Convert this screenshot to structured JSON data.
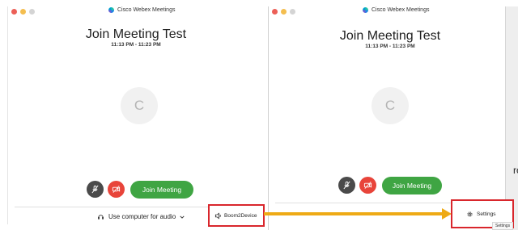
{
  "app_title": "Cisco Webex Meetings",
  "left_window": {
    "meeting_title": "Join Meeting Test",
    "meeting_time": "11:13 PM - 11:23 PM",
    "avatar_initial": "C",
    "join_label": "Join Meeting",
    "audio_option": "Use computer for audio",
    "audio_device": "Boom2Device"
  },
  "right_window": {
    "meeting_title": "Join Meeting Test",
    "meeting_time": "11:13 PM - 11:23 PM",
    "avatar_initial": "C",
    "join_label": "Join Meeting",
    "settings_label": "Settings",
    "settings_tooltip": "Settings"
  },
  "side_char": "rc",
  "colors": {
    "join_green": "#3fa543",
    "video_red": "#e8443a",
    "mute_gray": "#4a4a4a",
    "highlight_red": "#d9262c",
    "arrow_orange": "#eeaa15"
  },
  "icons": [
    "webex-logo-icon",
    "microphone-muted-icon",
    "video-muted-icon",
    "audio-connection-icon",
    "chevron-down-icon",
    "speaker-icon",
    "gear-icon",
    "arrow-icon"
  ]
}
